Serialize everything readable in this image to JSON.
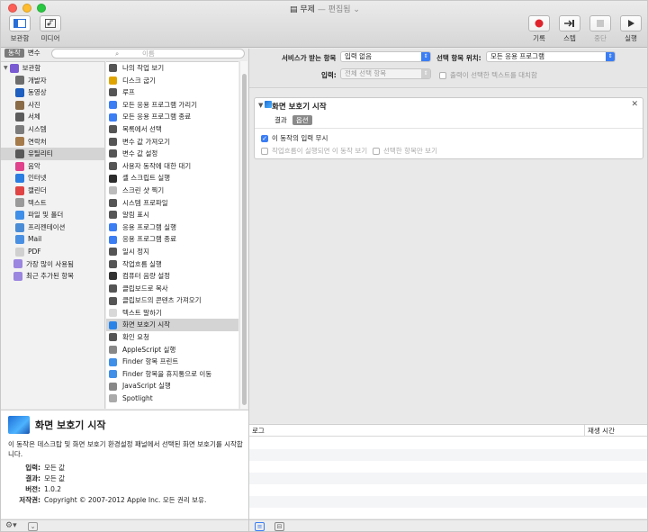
{
  "window": {
    "title": "무제",
    "subtitle": "— 편집됨",
    "subtitle_caret": "⌄"
  },
  "toolbar": {
    "library_label": "보관함",
    "media_label": "미디어",
    "record_label": "기록",
    "step_label": "스텝",
    "stop_label": "중단",
    "run_label": "실행"
  },
  "left": {
    "tab_actions": "동작",
    "tab_variables": "변수",
    "search_placeholder": "이름"
  },
  "library": {
    "items": [
      {
        "label": "보관함",
        "icon": "library-icon",
        "color": "#7a5ad2"
      },
      {
        "label": "개발자",
        "icon": "developer-icon",
        "color": "#6d6d6d"
      },
      {
        "label": "동영상",
        "icon": "movies-icon",
        "color": "#1e5fbf"
      },
      {
        "label": "사진",
        "icon": "photos-icon",
        "color": "#8a6b47"
      },
      {
        "label": "서체",
        "icon": "fonts-icon",
        "color": "#5c5c5c"
      },
      {
        "label": "시스템",
        "icon": "system-icon",
        "color": "#7c7c7c"
      },
      {
        "label": "연락처",
        "icon": "contacts-icon",
        "color": "#a67b4b"
      },
      {
        "label": "유틸리티",
        "icon": "utilities-icon",
        "color": "#585858"
      },
      {
        "label": "음악",
        "icon": "music-icon",
        "color": "#e0428b"
      },
      {
        "label": "인터넷",
        "icon": "internet-icon",
        "color": "#2a7de1"
      },
      {
        "label": "캘린더",
        "icon": "calendar-icon",
        "color": "#e04444"
      },
      {
        "label": "텍스트",
        "icon": "text-icon",
        "color": "#9a9a9a"
      },
      {
        "label": "파일 및 폴더",
        "icon": "finder-icon",
        "color": "#3f8fe8"
      },
      {
        "label": "프리젠테이션",
        "icon": "presentation-icon",
        "color": "#4a8cd6"
      },
      {
        "label": "Mail",
        "icon": "mail-icon",
        "color": "#4a90e2"
      },
      {
        "label": "PDF",
        "icon": "pdf-icon",
        "color": "#d0d0d0"
      },
      {
        "label": "가장 많이 사용됨",
        "icon": "smart-folder-icon",
        "color": "#9b86e0"
      },
      {
        "label": "최근 추가된 항목",
        "icon": "smart-folder-icon",
        "color": "#9b86e0"
      }
    ]
  },
  "actions": {
    "items": [
      {
        "label": "나의 작업 보기",
        "icon": "utilities-icon",
        "color": "#555555"
      },
      {
        "label": "디스크 굽기",
        "icon": "burn-icon",
        "color": "#e0a400"
      },
      {
        "label": "루프",
        "icon": "loop-icon",
        "color": "#555555"
      },
      {
        "label": "모든 응용 프로그램 가리기",
        "icon": "hide-apps-icon",
        "color": "#3b7df3"
      },
      {
        "label": "모든 응용 프로그램 종료",
        "icon": "quit-apps-icon",
        "color": "#3b7df3"
      },
      {
        "label": "목록에서 선택",
        "icon": "choose-list-icon",
        "color": "#555555"
      },
      {
        "label": "변수 값 가져오기",
        "icon": "variable-icon",
        "color": "#555555"
      },
      {
        "label": "변수 값 설정",
        "icon": "variable-icon",
        "color": "#555555"
      },
      {
        "label": "사용자 동작에 대한 대기",
        "icon": "wait-icon",
        "color": "#555555"
      },
      {
        "label": "셸 스크립트 실행",
        "icon": "terminal-icon",
        "color": "#2c2c2c"
      },
      {
        "label": "스크린 샷 찍기",
        "icon": "screenshot-icon",
        "color": "#bbbbbb"
      },
      {
        "label": "시스템 프로파일",
        "icon": "utilities-icon",
        "color": "#555555"
      },
      {
        "label": "알림 표시",
        "icon": "notification-icon",
        "color": "#555555"
      },
      {
        "label": "응용 프로그램 실행",
        "icon": "launch-app-icon",
        "color": "#3b7df3"
      },
      {
        "label": "응용 프로그램 종료",
        "icon": "quit-app-icon",
        "color": "#3b7df3"
      },
      {
        "label": "일시 정지",
        "icon": "pause-icon",
        "color": "#555555"
      },
      {
        "label": "작업흐름 실행",
        "icon": "workflow-icon",
        "color": "#555555"
      },
      {
        "label": "컴퓨터 음량 설정",
        "icon": "volume-icon",
        "color": "#333333"
      },
      {
        "label": "클립보드로 복사",
        "icon": "utilities-icon",
        "color": "#555555"
      },
      {
        "label": "클립보드의 콘텐츠 가져오기",
        "icon": "utilities-icon",
        "color": "#555555"
      },
      {
        "label": "텍스트 말하기",
        "icon": "speak-icon",
        "color": "#d8d8d8"
      },
      {
        "label": "화면 보호기 시작",
        "icon": "screensaver-icon",
        "color": "#2a84e8"
      },
      {
        "label": "확인 요청",
        "icon": "utilities-icon",
        "color": "#555555"
      },
      {
        "label": "AppleScript 실행",
        "icon": "applescript-icon",
        "color": "#888888"
      },
      {
        "label": "Finder 항목 프린트",
        "icon": "finder-icon",
        "color": "#3f8fe8"
      },
      {
        "label": "Finder 항목을 휴지통으로 이동",
        "icon": "finder-icon",
        "color": "#3f8fe8"
      },
      {
        "label": "JavaScript 실행",
        "icon": "javascript-icon",
        "color": "#888888"
      },
      {
        "label": "Spotlight",
        "icon": "spotlight-icon",
        "color": "#aaaaaa"
      }
    ]
  },
  "description": {
    "title": "화면 보호기 시작",
    "text": "이 동작은 데스크탑 및 화면 보호기 환경설정 패널에서 선택된 화면 보호기를 시작합니다.",
    "input_key": "입력:",
    "input_val": "모든 값",
    "result_key": "결과:",
    "result_val": "모든 값",
    "version_key": "버전:",
    "version_val": "1.0.2",
    "copyright_key": "저작권:",
    "copyright_val": "Copyright © 2007-2012 Apple Inc. 모든 권리 보유."
  },
  "workflow_header": {
    "service_receives_label": "서비스가 받는 항목",
    "service_receives_value": "입력 없음",
    "location_label": "선택 항목 위치:",
    "location_value": "모든 응용 프로그램",
    "input_label": "입력:",
    "input_value": "전체 선택 항목",
    "replace_text_label": "출력이 선택한 텍스트를 대치함"
  },
  "action_card": {
    "title": "화면 보호기 시작",
    "tab_results": "결과",
    "tab_options": "옵션",
    "ignore_input_label": "이 동작의 입력 무시",
    "show_on_run_label": "작업흐름이 실행되면 이 동작 보기",
    "selected_only_label": "선택한 항목만 보기"
  },
  "log": {
    "col_log": "로그",
    "col_duration": "재생 시간"
  },
  "colors": {
    "accent": "#3b7df3",
    "record_red": "#e0242d"
  }
}
